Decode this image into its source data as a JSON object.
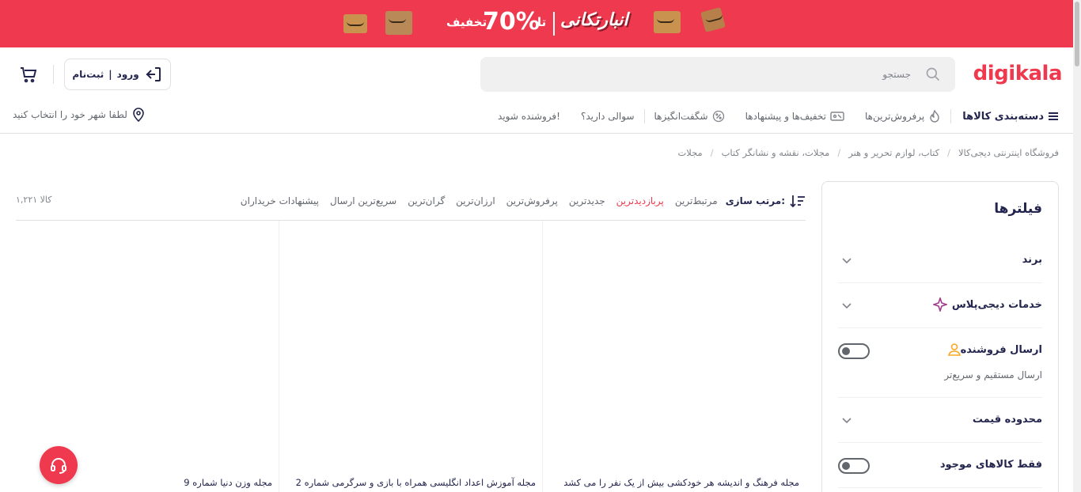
{
  "banner": {
    "discount_word": "تخفیف",
    "percent": "70%",
    "upto": "تا",
    "brand_script": "انبارتکانی",
    "bg_color": "#ef394e"
  },
  "header": {
    "logo": "digikala",
    "search_placeholder": "جستجو",
    "login_label": "ورود",
    "login_sep": "|",
    "register_label": "ثبت‌نام",
    "brand_color": "#ef394e"
  },
  "nav": {
    "categories": "دسته‌بندی کالاها",
    "items": [
      "پرفروش‌ترین‌ها",
      "تخفیف‌ها و پیشنهادها",
      "شگفت‌انگیزها",
      "سوالی دارید؟",
      "فروشنده شوید!"
    ],
    "city": "لطفا شهر خود را انتخاب کنید"
  },
  "breadcrumb": [
    "فروشگاه اینترنتی دیجی‌کالا",
    "کتاب، لوازم تحریر و هنر",
    "مجلات، نقشه و نشانگر کتاب",
    "مجلات"
  ],
  "filters": {
    "title": "فیلترها",
    "brand": "برند",
    "digiplus": "خدمات دیجی‌پلاس",
    "seller_ship": "ارسال فروشنده",
    "seller_ship_sub": "ارسال مستقیم و سریع‌تر",
    "price_range": "محدوده قیمت",
    "in_stock": "فقط کالاهای موجود"
  },
  "sort": {
    "label": "مرتب سازی:",
    "options": [
      "مرتبط‌ترین",
      "پربازدیدترین",
      "جدیدترین",
      "پرفروش‌ترین",
      "ارزان‌ترین",
      "گران‌ترین",
      "سریع‌ترین ارسال",
      "پیشنهادات خریداران"
    ],
    "active_index": 1,
    "count": "۱,۲۲۱ کالا"
  },
  "products": [
    {
      "title": "مجله فرهنگ و اندیشه هر خودکشی بیش از یک نفر را می کشد"
    },
    {
      "title": "مجله آموزش اعداد انگلیسی همراه با بازی و سرگرمی شماره 2"
    },
    {
      "title": "مجله وزن دنیا شماره 9"
    }
  ]
}
